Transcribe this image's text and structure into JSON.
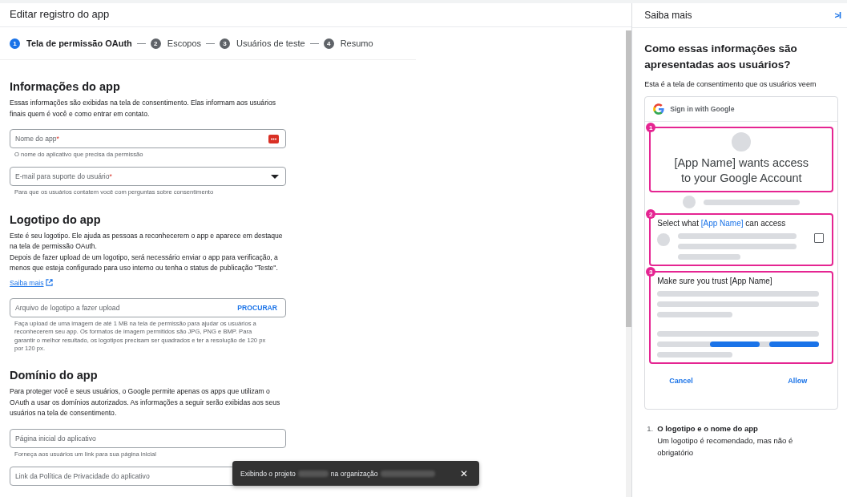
{
  "header": {
    "title": "Editar registro do app"
  },
  "steps": [
    {
      "number": "1",
      "label": "Tela de permissão OAuth",
      "selected": true
    },
    {
      "number": "2",
      "label": "Escopos",
      "selected": false
    },
    {
      "number": "3",
      "label": "Usuários de teste",
      "selected": false
    },
    {
      "number": "4",
      "label": "Resumo",
      "selected": false
    }
  ],
  "sections": [
    {
      "title": "Informações do app",
      "paragraphs": [
        "Essas informações são exibidas na tela de consentimento. Elas informam aos usuários finais quem é você e como entrar em contato."
      ],
      "fields": [
        {
          "kind": "text",
          "label": "Nome do app",
          "required_mark": "*",
          "autofill": true,
          "hint": "O nome do aplicativo que precisa da permissão"
        },
        {
          "kind": "select",
          "label": "E-mail para suporte do usuário",
          "required_mark": "*",
          "hint": "Para que os usuários contatem você com perguntas sobre consentimento"
        }
      ]
    },
    {
      "title": "Logotipo do app",
      "paragraphs": [
        "Este é seu logotipo. Ele ajuda as pessoas a reconhecerem o app e aparece em destaque na tela de permissão OAuth.",
        "Depois de fazer upload de um logotipo, será necessário enviar o app para verificação, a menos que esteja configurado para uso interno ou tenha o status de publicação \"Teste\"."
      ],
      "link": "Saiba mais",
      "fields": [
        {
          "kind": "upload",
          "label": "Arquivo de logotipo a fazer upload",
          "action": "PROCURAR",
          "hint": "Faça upload de uma imagem de até 1 MB na tela de permissão para ajudar os usuários a reconhecerem seu app. Os formatos de imagem permitidos são JPG, PNG e BMP. Para garantir o melhor resultado, os logotipos precisam ser quadrados e ter a resolução de 120 px por 120 px."
        }
      ]
    },
    {
      "title": "Domínio do app",
      "paragraphs": [
        "Para proteger você e seus usuários, o Google permite apenas os apps que utilizam o OAuth a usar os domínios autorizados. As informações a seguir serão exibidas aos seus usuários na tela de consentimento."
      ],
      "fields": [
        {
          "kind": "text",
          "label": "Página inicial do aplicativo",
          "hint": "Forneça aos usuários um link para sua página inicial"
        },
        {
          "kind": "text",
          "label": "Link da Política de Privacidade do aplicativo"
        }
      ]
    }
  ],
  "snackbar": {
    "text_1": "Exibindo o projeto",
    "text_2": "na organização",
    "close": "✕"
  },
  "side_panel": {
    "title": "Saiba mais",
    "collapse": ">I",
    "heading": "Como essas informações são apresentadas aos usuários?",
    "intro": "Esta é a tela de consentimento que os usuários veem",
    "preview": {
      "sign_in": "Sign in with Google",
      "badges": [
        "1",
        "2",
        "3"
      ],
      "wants_access": "[App Name] wants access to your Google Account",
      "select_prefix": "Select what",
      "select_app": "[App Name]",
      "select_suffix": "can access",
      "trust": "Make sure you trust [App Name]",
      "cancel": "Cancel",
      "allow": "Allow"
    },
    "notes": [
      {
        "number": "1.",
        "title": "O logotipo e o nome do app",
        "text": "Um logotipo é recomendado, mas não é obrigatório"
      }
    ]
  }
}
